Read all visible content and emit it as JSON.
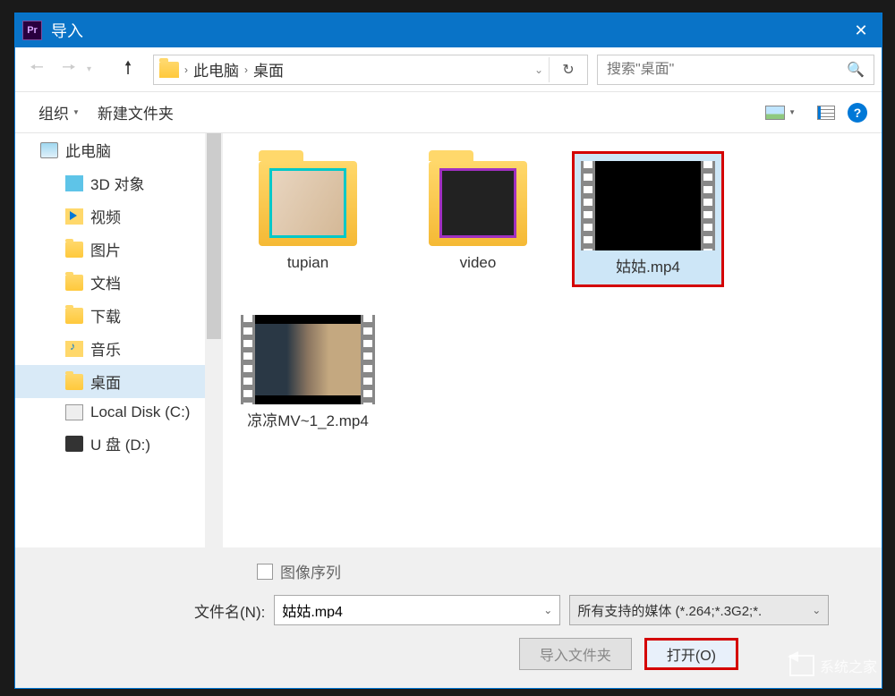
{
  "titlebar": {
    "app_abbr": "Pr",
    "title": "导入"
  },
  "nav": {
    "breadcrumb": [
      {
        "label": "此电脑"
      },
      {
        "label": "桌面"
      }
    ],
    "search_placeholder": "搜索\"桌面\""
  },
  "toolbar": {
    "organize": "组织",
    "newfolder": "新建文件夹"
  },
  "sidebar": {
    "items": [
      {
        "label": "此电脑",
        "level": 0,
        "icon": "pc",
        "selected": false
      },
      {
        "label": "3D 对象",
        "level": 1,
        "icon": "3d",
        "selected": false
      },
      {
        "label": "视频",
        "level": 1,
        "icon": "video",
        "selected": false
      },
      {
        "label": "图片",
        "level": 1,
        "icon": "folder",
        "selected": false
      },
      {
        "label": "文档",
        "level": 1,
        "icon": "folder",
        "selected": false
      },
      {
        "label": "下载",
        "level": 1,
        "icon": "folder",
        "selected": false
      },
      {
        "label": "音乐",
        "level": 1,
        "icon": "music",
        "selected": false
      },
      {
        "label": "桌面",
        "level": 1,
        "icon": "folder",
        "selected": true
      },
      {
        "label": "Local Disk (C:)",
        "level": 1,
        "icon": "disk",
        "selected": false
      },
      {
        "label": "U 盘 (D:)",
        "level": 1,
        "icon": "usb",
        "selected": false
      }
    ]
  },
  "files": [
    {
      "name": "tupian",
      "type": "folder",
      "variant": "tupian",
      "selected": false,
      "highlighted": false
    },
    {
      "name": "video",
      "type": "folder",
      "variant": "video",
      "selected": false,
      "highlighted": false
    },
    {
      "name": "姑姑.mp4",
      "type": "video",
      "variant": "black",
      "selected": true,
      "highlighted": true
    },
    {
      "name": "凉凉MV~1_2.mp4",
      "type": "video",
      "variant": "liang",
      "selected": false,
      "highlighted": false
    }
  ],
  "bottom": {
    "sequence_label": "图像序列",
    "filename_label": "文件名(N):",
    "filename_value": "姑姑.mp4",
    "filter_label": "所有支持的媒体 (*.264;*.3G2;*.",
    "import_folder": "导入文件夹",
    "open": "打开(O)"
  },
  "watermark": "系统之家"
}
